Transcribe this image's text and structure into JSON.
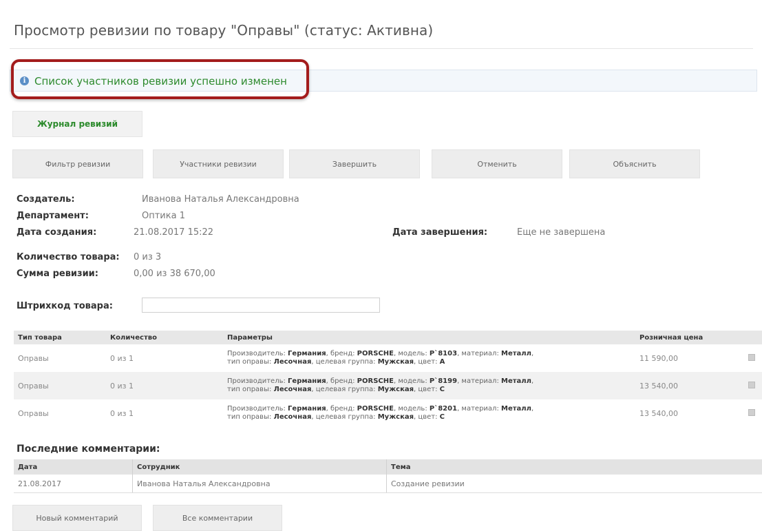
{
  "page": {
    "title": "Просмотр ревизии по товару \"Оправы\" (статус: Активна)"
  },
  "notice": {
    "text": "Список участников ревизии успешно изменен",
    "icon": "info-icon",
    "icon_glyph": "i",
    "color": "#2d8a2d",
    "highlight_color": "#a31c1c"
  },
  "tabs": {
    "journal_label": "Журнал ревизий"
  },
  "toolbar": {
    "filter_label": "Фильтр ревизии",
    "participants_label": "Участники ревизии",
    "finish_label": "Завершить",
    "cancel_label": "Отменить",
    "explain_label": "Объяснить"
  },
  "details": {
    "creator_label": "Создатель:",
    "creator_value": "Иванова Наталья Александровна",
    "department_label": "Департамент:",
    "department_value": "Оптика 1",
    "created_label": "Дата создания:",
    "created_value": "21.08.2017 15:22",
    "finished_label": "Дата завершения:",
    "finished_value": "Еще не завершена",
    "quantity_label": "Количество товара:",
    "quantity_value": "0 из 3",
    "sum_label": "Сумма ревизии:",
    "sum_value": "0,00 из 38 670,00",
    "barcode_label": "Штрихкод товара:",
    "barcode_value": ""
  },
  "goods": {
    "columns": {
      "type": "Тип товара",
      "quantity": "Количество",
      "params": "Параметры",
      "price": "Розничная цена"
    },
    "param_labels": {
      "manufacturer": "Производитель:",
      "brand": "бренд:",
      "model": "модель:",
      "material": "материал:",
      "frame_type": "тип оправы:",
      "target": "целевая группа:",
      "color": "цвет:"
    },
    "rows": [
      {
        "type": "Оправы",
        "quantity": "0 из 1",
        "manufacturer": "Германия",
        "brand": "PORSCHE",
        "model": "P`8103",
        "material": "Металл",
        "frame_type": "Лесочная",
        "target": "Мужская",
        "color": "A",
        "price": "11 590,00"
      },
      {
        "type": "Оправы",
        "quantity": "0 из 1",
        "manufacturer": "Германия",
        "brand": "PORSCHE",
        "model": "P`8199",
        "material": "Металл",
        "frame_type": "Лесочная",
        "target": "Мужская",
        "color": "C",
        "price": "13 540,00"
      },
      {
        "type": "Оправы",
        "quantity": "0 из 1",
        "manufacturer": "Германия",
        "brand": "PORSCHE",
        "model": "P`8201",
        "material": "Металл",
        "frame_type": "Лесочная",
        "target": "Мужская",
        "color": "C",
        "price": "13 540,00"
      }
    ]
  },
  "comments": {
    "title": "Последние комментарии:",
    "columns": {
      "date": "Дата",
      "employee": "Сотрудник",
      "topic": "Тема"
    },
    "rows": [
      {
        "date": "21.08.2017",
        "employee": "Иванова Наталья Александровна",
        "topic": "Создание ревизии"
      }
    ],
    "new_label": "Новый комментарий",
    "all_label": "Все комментарии"
  }
}
